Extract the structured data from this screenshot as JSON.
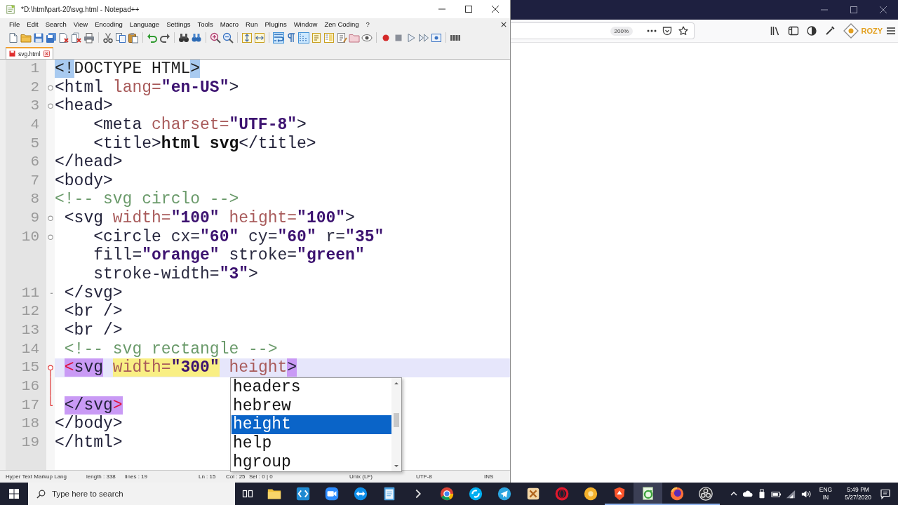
{
  "notepad": {
    "title": "*D:\\html\\part-20\\svg.html - Notepad++",
    "menu": [
      "File",
      "Edit",
      "Search",
      "View",
      "Encoding",
      "Language",
      "Settings",
      "Tools",
      "Macro",
      "Run",
      "Plugins",
      "Window",
      "Zen Coding",
      "?"
    ],
    "toolbar": [
      [
        {
          "kind": "new",
          "pressed": false
        },
        {
          "kind": "open",
          "pressed": false
        },
        {
          "kind": "save",
          "pressed": false
        },
        {
          "kind": "saveall",
          "pressed": false
        },
        {
          "kind": "close",
          "pressed": false
        },
        {
          "kind": "closeall",
          "pressed": false
        },
        {
          "kind": "print",
          "pressed": false
        }
      ],
      [
        {
          "kind": "cut",
          "pressed": false
        },
        {
          "kind": "copy",
          "pressed": false
        },
        {
          "kind": "paste",
          "pressed": false
        }
      ],
      [
        {
          "kind": "undo",
          "pressed": false
        },
        {
          "kind": "redo",
          "pressed": false
        }
      ],
      [
        {
          "kind": "find",
          "pressed": false
        },
        {
          "kind": "replace",
          "pressed": false
        }
      ],
      [
        {
          "kind": "zoomin",
          "pressed": false
        },
        {
          "kind": "zoomout",
          "pressed": false
        }
      ],
      [
        {
          "kind": "syncv",
          "pressed": false
        },
        {
          "kind": "synch",
          "pressed": false
        }
      ],
      [
        {
          "kind": "wrap",
          "pressed": true
        },
        {
          "kind": "allchars",
          "pressed": false
        },
        {
          "kind": "indent",
          "pressed": true
        },
        {
          "kind": "udl",
          "pressed": false
        },
        {
          "kind": "docmap",
          "pressed": false
        },
        {
          "kind": "funclist",
          "pressed": false
        },
        {
          "kind": "folder",
          "pressed": false
        },
        {
          "kind": "monitor",
          "pressed": false
        }
      ],
      [
        {
          "kind": "record",
          "pressed": false
        },
        {
          "kind": "stop",
          "pressed": false
        },
        {
          "kind": "play",
          "pressed": false
        },
        {
          "kind": "playmulti",
          "pressed": false
        },
        {
          "kind": "savemacro",
          "pressed": false
        }
      ],
      [
        {
          "kind": "bars",
          "pressed": false
        }
      ]
    ],
    "tabs": [
      {
        "label": "svg.html",
        "selected": true,
        "modified": true
      }
    ],
    "lines": [
      {
        "number": "1",
        "current": false,
        "fold_start": false,
        "fold_end": false,
        "fold_active": false,
        "rows": [
          {
            "tokens": [
              {
                "kind": "brace",
                "text": "<!"
              },
              {
                "kind": "plain",
                "text": "DOCTYPE HTML"
              },
              {
                "kind": "brace",
                "text": ">"
              }
            ]
          }
        ]
      },
      {
        "number": "2",
        "current": false,
        "fold_start": true,
        "fold_end": false,
        "fold_active": false,
        "rows": [
          {
            "tokens": [
              {
                "kind": "tag",
                "text": "<html "
              },
              {
                "kind": "attr",
                "text": "lang="
              },
              {
                "kind": "value",
                "text": "\"en-US\""
              },
              {
                "kind": "tag",
                "text": ">"
              }
            ]
          }
        ]
      },
      {
        "number": "3",
        "current": false,
        "fold_start": true,
        "fold_end": false,
        "fold_active": false,
        "rows": [
          {
            "tokens": [
              {
                "kind": "tag",
                "text": "<head>"
              }
            ]
          }
        ]
      },
      {
        "number": "4",
        "current": false,
        "fold_start": false,
        "fold_end": false,
        "fold_active": false,
        "rows": [
          {
            "tokens": [
              {
                "kind": "tag",
                "text": "    <meta "
              },
              {
                "kind": "attr",
                "text": "charset="
              },
              {
                "kind": "value",
                "text": "\"UTF-8\""
              },
              {
                "kind": "tag",
                "text": ">"
              }
            ]
          }
        ]
      },
      {
        "number": "5",
        "current": false,
        "fold_start": false,
        "fold_end": false,
        "fold_active": false,
        "rows": [
          {
            "tokens": [
              {
                "kind": "tag",
                "text": "    <title>"
              },
              {
                "kind": "text",
                "text": "html svg"
              },
              {
                "kind": "tag",
                "text": "</title>"
              }
            ]
          }
        ]
      },
      {
        "number": "6",
        "current": false,
        "fold_start": false,
        "fold_end": false,
        "fold_active": false,
        "rows": [
          {
            "tokens": [
              {
                "kind": "tag",
                "text": "</head>"
              }
            ]
          }
        ]
      },
      {
        "number": "7",
        "current": false,
        "fold_start": false,
        "fold_end": false,
        "fold_active": false,
        "rows": [
          {
            "tokens": [
              {
                "kind": "tag",
                "text": "<body>"
              }
            ]
          }
        ]
      },
      {
        "number": "8",
        "current": false,
        "fold_start": false,
        "fold_end": false,
        "fold_active": false,
        "rows": [
          {
            "tokens": [
              {
                "kind": "comment",
                "text": "<!-- svg circlo -->"
              }
            ]
          }
        ]
      },
      {
        "number": "9",
        "current": false,
        "fold_start": true,
        "fold_end": false,
        "fold_active": false,
        "rows": [
          {
            "tokens": [
              {
                "kind": "tag",
                "text": " <svg "
              },
              {
                "kind": "attr",
                "text": "width="
              },
              {
                "kind": "value",
                "text": "\"100\" "
              },
              {
                "kind": "attr",
                "text": "height="
              },
              {
                "kind": "value",
                "text": "\"100\""
              },
              {
                "kind": "tag",
                "text": ">"
              }
            ]
          }
        ]
      },
      {
        "number": "10",
        "current": false,
        "fold_start": true,
        "fold_end": false,
        "fold_active": false,
        "rows": [
          {
            "tokens": [
              {
                "kind": "tag",
                "text": "    <circle "
              },
              {
                "kind": "unknownattr",
                "text": "cx="
              },
              {
                "kind": "value",
                "text": "\"60\" "
              },
              {
                "kind": "unknownattr",
                "text": "cy="
              },
              {
                "kind": "value",
                "text": "\"60\" "
              },
              {
                "kind": "unknownattr",
                "text": "r="
              },
              {
                "kind": "value",
                "text": "\"35\""
              }
            ]
          },
          {
            "tokens": [
              {
                "kind": "unknownattr",
                "text": "fill="
              },
              {
                "kind": "value",
                "text": "\"orange\" "
              },
              {
                "kind": "unknownattr",
                "text": "stroke="
              },
              {
                "kind": "value",
                "text": "\"green\""
              }
            ]
          },
          {
            "tokens": [
              {
                "kind": "unknownattr",
                "text": "stroke-width="
              },
              {
                "kind": "value",
                "text": "\"3\""
              },
              {
                "kind": "tag",
                "text": ">"
              }
            ]
          }
        ]
      },
      {
        "number": "11",
        "current": false,
        "fold_start": false,
        "fold_end": true,
        "fold_active": false,
        "rows": [
          {
            "tokens": [
              {
                "kind": "tag",
                "text": " </svg>"
              }
            ]
          }
        ]
      },
      {
        "number": "12",
        "current": false,
        "fold_start": false,
        "fold_end": false,
        "fold_active": false,
        "rows": [
          {
            "tokens": [
              {
                "kind": "tag",
                "text": " <br />"
              }
            ]
          }
        ]
      },
      {
        "number": "13",
        "current": false,
        "fold_start": false,
        "fold_end": false,
        "fold_active": false,
        "rows": [
          {
            "tokens": [
              {
                "kind": "tag",
                "text": " <br />"
              }
            ]
          }
        ]
      },
      {
        "number": "14",
        "current": false,
        "fold_start": false,
        "fold_end": false,
        "fold_active": false,
        "rows": [
          {
            "tokens": [
              {
                "kind": "comment",
                "text": " <!-- svg rectangle -->"
              }
            ]
          }
        ]
      },
      {
        "number": "15",
        "current": true,
        "fold_start": true,
        "fold_end": false,
        "fold_active": true,
        "rows": [
          {
            "tokens": [
              {
                "kind": "matchbracket",
                "text": " <"
              },
              {
                "kind": "matchtag",
                "text": "svg"
              },
              {
                "kind": "matchattr",
                "text": " width="
              },
              {
                "kind": "matchvalue",
                "text": "\"300\""
              },
              {
                "kind": "attr",
                "text": " height"
              },
              {
                "kind": "matchtag",
                "text": ">"
              }
            ]
          }
        ]
      },
      {
        "number": "16",
        "current": false,
        "fold_start": false,
        "fold_end": false,
        "fold_active": true
      },
      {
        "number": "17",
        "current": false,
        "fold_start": false,
        "fold_end": true,
        "fold_active": true,
        "rows": [
          {
            "tokens": [
              {
                "kind": "matchtag",
                "text": " </svg"
              },
              {
                "kind": "matchbracket",
                "text": ">"
              }
            ]
          }
        ]
      },
      {
        "number": "18",
        "current": false,
        "fold_start": false,
        "fold_end": false,
        "fold_active": false,
        "rows": [
          {
            "tokens": [
              {
                "kind": "tag",
                "text": "</body>"
              }
            ]
          }
        ]
      },
      {
        "number": "19",
        "current": false,
        "fold_start": false,
        "fold_end": false,
        "fold_active": false,
        "rows": [
          {
            "tokens": [
              {
                "kind": "tag",
                "text": "</html>"
              }
            ]
          }
        ]
      }
    ],
    "autocomplete": {
      "items": [
        {
          "label": "headers",
          "selected": false
        },
        {
          "label": "hebrew",
          "selected": false
        },
        {
          "label": "height",
          "selected": true
        },
        {
          "label": "help",
          "selected": false
        },
        {
          "label": "hgroup",
          "selected": false
        }
      ]
    },
    "status_bar": [
      "Hyper Text Markup Lang",
      "length : 338",
      "lines : 19",
      "Ln : 15",
      "Col : 25",
      "Sel : 0 | 0",
      "Unix (LF)",
      "UTF-8",
      "INS"
    ]
  },
  "browser": {
    "zoom": "200%",
    "logo_text": "ROZY"
  },
  "taskbar": {
    "search": {
      "placeholder": "Type here to search"
    },
    "apps": [
      {
        "kind": "folder",
        "running": false,
        "active": false
      },
      {
        "kind": "brackets",
        "running": false,
        "active": false
      },
      {
        "kind": "video",
        "running": false,
        "active": false
      },
      {
        "kind": "arrows",
        "running": false,
        "active": false
      },
      {
        "kind": "notepad",
        "running": false,
        "active": false
      },
      {
        "kind": "chevron",
        "running": false,
        "active": false
      },
      {
        "kind": "wheel",
        "running": false,
        "active": false
      },
      {
        "kind": "swirl",
        "running": false,
        "active": false
      },
      {
        "kind": "plane",
        "running": false,
        "active": false
      },
      {
        "kind": "box",
        "running": false,
        "active": false
      },
      {
        "kind": "ring",
        "running": false,
        "active": false
      },
      {
        "kind": "coin",
        "running": false,
        "active": false
      },
      {
        "kind": "shield",
        "running": true,
        "active": false
      },
      {
        "kind": "editor",
        "running": true,
        "active": true
      },
      {
        "kind": "globe",
        "running": true,
        "active": false
      },
      {
        "kind": "aperture",
        "running": true,
        "active": false
      }
    ],
    "language": "ENG",
    "region": "IN",
    "time": "5:49 PM",
    "date": "5/27/2020"
  }
}
